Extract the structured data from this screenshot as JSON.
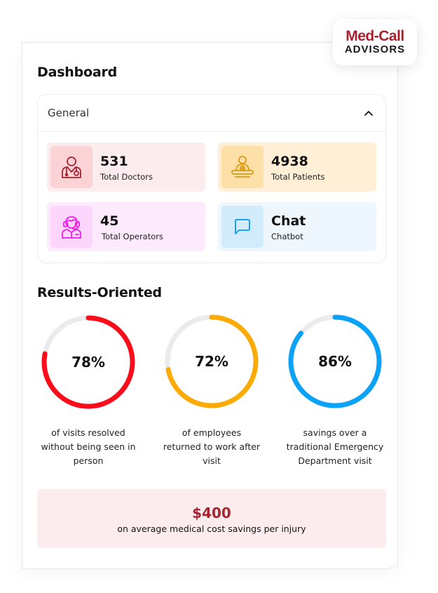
{
  "brand": {
    "name_top": "Med-Call",
    "name_bottom": "ADVISORS",
    "color": "#a8232f"
  },
  "page": {
    "title": "Dashboard"
  },
  "general_panel": {
    "header": "General",
    "toggle_icon": "chevron-up-icon",
    "expanded": true,
    "stats": [
      {
        "value": "531",
        "label": "Total Doctors",
        "icon": "doctor-icon",
        "bg": "#fdecee",
        "icon_bg": "#fbd3d6",
        "icon_color": "#a8232f"
      },
      {
        "value": "4938",
        "label": "Total Patients",
        "icon": "patient-icon",
        "bg": "#feefd6",
        "icon_bg": "#fde0a8",
        "icon_color": "#d99a12"
      },
      {
        "value": "45",
        "label": "Total Operators",
        "icon": "operator-headset-icon",
        "bg": "#fdeafd",
        "icon_bg": "#fcd6fc",
        "icon_color": "#f01df0"
      },
      {
        "value": "Chat",
        "label": "Chatbot",
        "icon": "chat-bubble-icon",
        "bg": "#eef7fe",
        "icon_bg": "#d2ebfd",
        "icon_color": "#1aa3f5"
      }
    ]
  },
  "results": {
    "title": "Results-Oriented",
    "metrics": [
      {
        "percent": 78,
        "display": "78%",
        "caption_lines": [
          "of visits resolved",
          "without being seen in",
          "person"
        ],
        "color": "#fb0d1b"
      },
      {
        "percent": 72,
        "display": "72%",
        "caption_lines": [
          "of employees",
          "returned to work after",
          "visit"
        ],
        "color": "#fcab06"
      },
      {
        "percent": 86,
        "display": "86%",
        "caption_lines": [
          "savings over a",
          "traditional Emergency",
          "Department visit"
        ],
        "color": "#0ca2f7"
      }
    ],
    "track_color": "#ebebeb"
  },
  "savings": {
    "value": "$400",
    "label": "on average medical cost savings per injury"
  }
}
